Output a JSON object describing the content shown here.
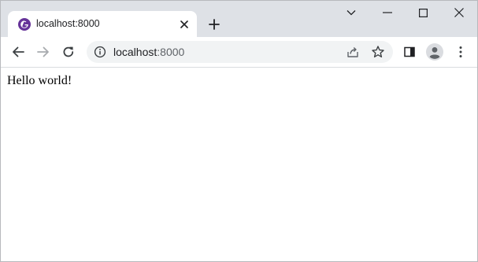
{
  "tab": {
    "title": "localhost:8000",
    "favicon": "gatsby-logo-icon"
  },
  "window_controls": {
    "tab_search_icon": "chevron-down-icon",
    "minimize_icon": "minimize-icon",
    "maximize_icon": "maximize-icon",
    "close_icon": "close-icon"
  },
  "toolbar": {
    "back_icon": "back-arrow-icon",
    "forward_icon": "forward-arrow-icon",
    "reload_icon": "reload-icon",
    "sidepanel_icon": "side-panel-icon",
    "profile_icon": "profile-avatar-icon",
    "menu_icon": "more-vert-icon"
  },
  "address_bar": {
    "host": "localhost",
    "port": ":8000",
    "site_info_icon": "info-icon",
    "share_icon": "share-icon",
    "bookmark_icon": "star-icon"
  },
  "page": {
    "text": "Hello world!"
  },
  "colors": {
    "tabstrip_bg": "#dee1e6",
    "omnibox_bg": "#f1f3f4",
    "favicon_purple": "#663399",
    "icon_gray": "#5f6368"
  }
}
